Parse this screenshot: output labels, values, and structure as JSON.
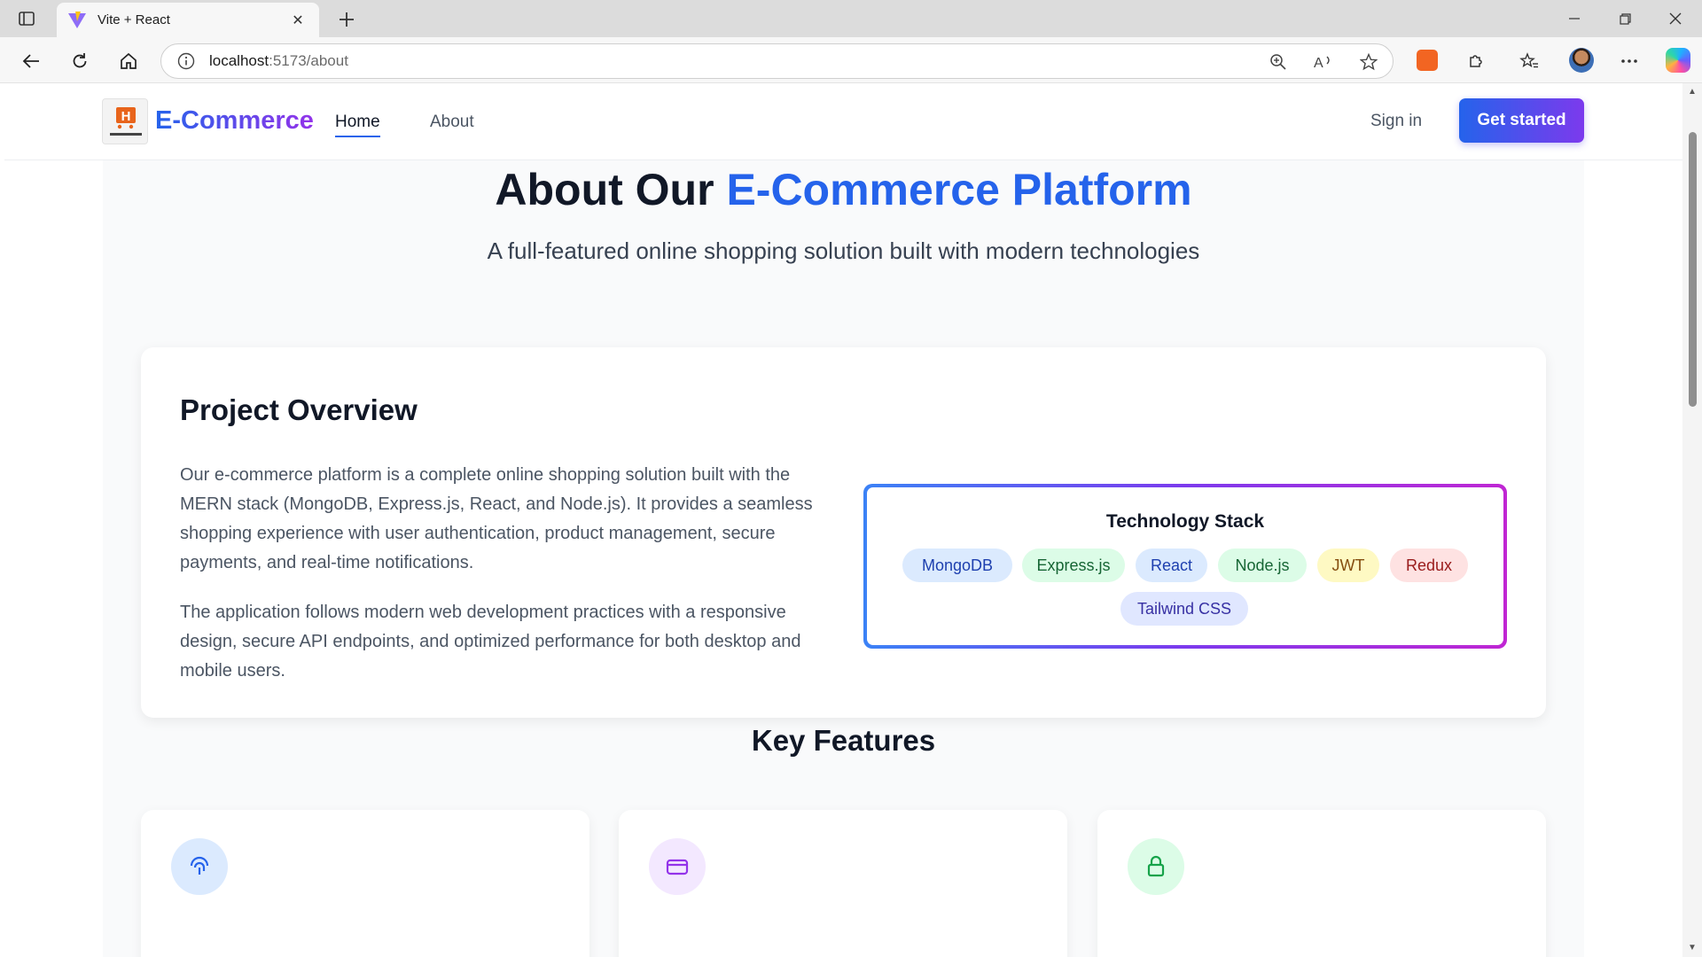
{
  "browser": {
    "tab_title": "Vite + React",
    "url_host": "localhost",
    "url_path": ":5173/about"
  },
  "nav": {
    "brand": "E-Commerce",
    "links": [
      "Home",
      "About"
    ],
    "active": "Home",
    "signin": "Sign in",
    "cta": "Get started"
  },
  "hero": {
    "title_main": "About Our ",
    "title_accent": "E-Commerce Platform",
    "subtitle": "A full-featured online shopping solution built with modern technologies"
  },
  "overview": {
    "title": "Project Overview",
    "paragraphs": [
      "Our e-commerce platform is a complete online shopping solution built with the MERN stack (MongoDB, Express.js, React, and Node.js). It provides a seamless shopping experience with user authentication, product management, secure payments, and real-time notifications.",
      "The application follows modern web development practices with a responsive design, secure API endpoints, and optimized performance for both desktop and mobile users."
    ],
    "stack_title": "Technology Stack",
    "stack": [
      {
        "label": "MongoDB",
        "bg": "#dbeafe",
        "fg": "#1e40af"
      },
      {
        "label": "Express.js",
        "bg": "#dcfce7",
        "fg": "#166534"
      },
      {
        "label": "React",
        "bg": "#dbeafe",
        "fg": "#1e40af"
      },
      {
        "label": "Node.js",
        "bg": "#dcfce7",
        "fg": "#166534"
      },
      {
        "label": "JWT",
        "bg": "#fef9c3",
        "fg": "#854d0e"
      },
      {
        "label": "Redux",
        "bg": "#fee2e2",
        "fg": "#991b1b"
      },
      {
        "label": "Tailwind CSS",
        "bg": "#e0e7ff",
        "fg": "#3730a3"
      }
    ]
  },
  "features": {
    "title": "Key Features",
    "icons": [
      {
        "name": "fingerprint-icon",
        "bg": "#dbeafe",
        "fg": "#2563eb"
      },
      {
        "name": "card-icon",
        "bg": "#f3e8ff",
        "fg": "#9333ea"
      },
      {
        "name": "lock-icon",
        "bg": "#dcfce7",
        "fg": "#16a34a"
      }
    ]
  },
  "colors": {
    "accent": "#2563eb",
    "brand_gradient_start": "#2563eb",
    "brand_gradient_end": "#9333ea"
  }
}
